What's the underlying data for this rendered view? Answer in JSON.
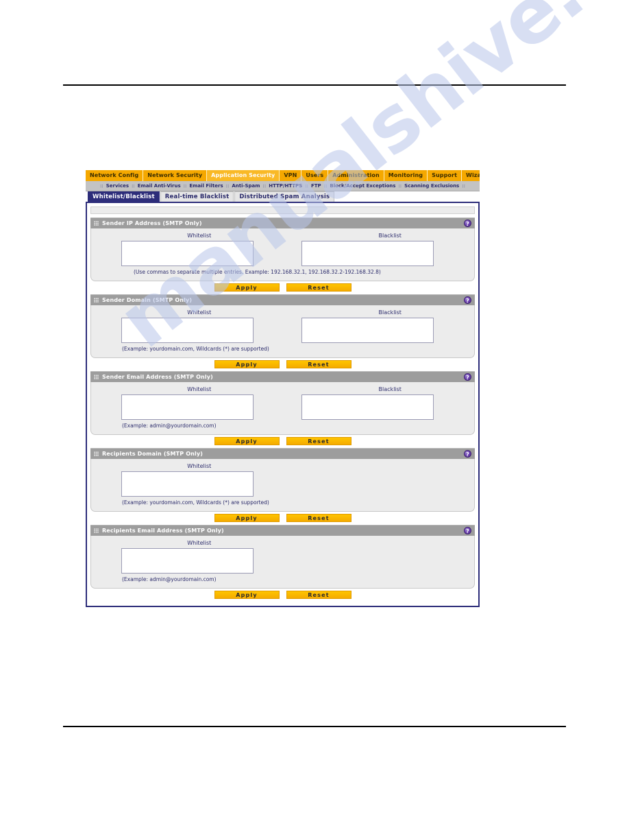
{
  "watermark": {
    "text": "manualshive.com"
  },
  "nav": {
    "main_items": [
      {
        "label": "Network Config",
        "active": false
      },
      {
        "label": "Network Security",
        "active": false
      },
      {
        "label": "Application Security",
        "active": true
      },
      {
        "label": "VPN",
        "active": false
      },
      {
        "label": "Users",
        "active": false
      },
      {
        "label": "Administration",
        "active": false
      },
      {
        "label": "Monitoring",
        "active": false
      },
      {
        "label": "Support",
        "active": false
      },
      {
        "label": "Wizards",
        "active": false
      }
    ],
    "sub_items": [
      "Services",
      "Email Anti-Virus",
      "Email Filters",
      "Anti-Spam",
      "HTTP/HTTPS",
      "FTP",
      "Block/Accept Exceptions",
      "Scanning Exclusions"
    ],
    "sub_separator": "::"
  },
  "tabs": [
    {
      "label": "Whitelist/Blacklist",
      "active": true
    },
    {
      "label": "Real-time Blacklist",
      "active": false
    },
    {
      "label": "Distributed Spam Analysis",
      "active": false
    }
  ],
  "buttons": {
    "apply": "Apply",
    "reset": "Reset"
  },
  "labels": {
    "whitelist": "Whitelist",
    "blacklist": "Blacklist",
    "help": "?"
  },
  "sections": [
    {
      "title": "Sender IP Address (SMTP Only)",
      "whitelist_value": "",
      "blacklist_value": "",
      "has_blacklist": true,
      "hint": "(Use commas to separate multiple entries. Example: 192.168.32.1, 192.168.32.2-192.168.32.8)"
    },
    {
      "title": "Sender Domain (SMTP Only)",
      "whitelist_value": "",
      "blacklist_value": "",
      "has_blacklist": true,
      "hint": "(Example: yourdomain.com, Wildcards (*) are supported)"
    },
    {
      "title": "Sender Email Address (SMTP Only)",
      "whitelist_value": "",
      "blacklist_value": "",
      "has_blacklist": true,
      "hint": "(Example: admin@yourdomain.com)"
    },
    {
      "title": "Recipients Domain (SMTP Only)",
      "whitelist_value": "",
      "blacklist_value": "",
      "has_blacklist": false,
      "hint": "(Example: yourdomain.com, Wildcards (*) are supported)"
    },
    {
      "title": "Recipients Email Address (SMTP Only)",
      "whitelist_value": "",
      "blacklist_value": "",
      "has_blacklist": false,
      "hint": "(Example: admin@yourdomain.com)"
    }
  ],
  "colors": {
    "nav_orange": "#f5a800",
    "nav_sub_gray": "#c3c3c3",
    "tab_active_navy": "#2d2d7a",
    "section_header_gray": "#9d9d9d",
    "button_gold": "#ffc400",
    "help_purple": "#6b3fae"
  }
}
